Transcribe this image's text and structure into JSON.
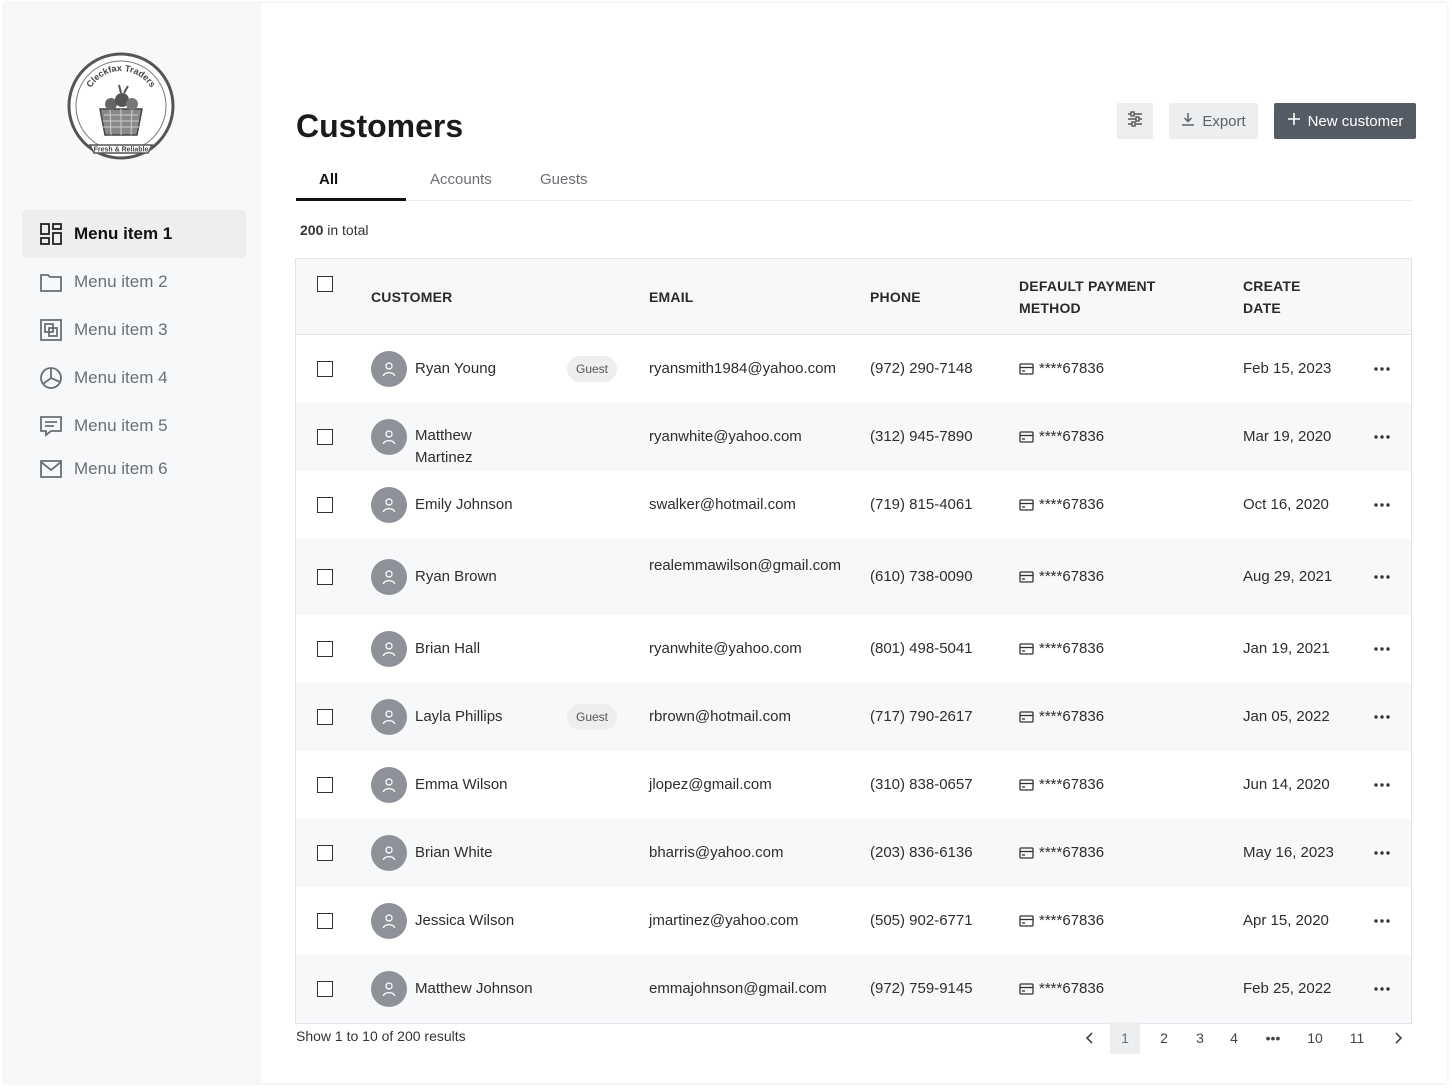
{
  "brand": {
    "logo_text_top": "Cleckfax Traders",
    "logo_text_bottom": "Fresh & Reliable"
  },
  "sidebar": {
    "items": [
      {
        "label": "Menu item 1",
        "icon": "dashboard-icon"
      },
      {
        "label": "Menu item 2",
        "icon": "folder-icon"
      },
      {
        "label": "Menu item 3",
        "icon": "layers-icon"
      },
      {
        "label": "Menu item 4",
        "icon": "pie-chart-icon"
      },
      {
        "label": "Menu item 5",
        "icon": "message-icon"
      },
      {
        "label": "Menu item 6",
        "icon": "mail-icon"
      }
    ]
  },
  "header": {
    "title": "Customers",
    "export_label": "Export",
    "new_label": "New customer"
  },
  "tabs": [
    "All",
    "Accounts",
    "Guests"
  ],
  "summary": {
    "count": "200",
    "suffix": " in total"
  },
  "table": {
    "headers": {
      "customer": "CUSTOMER",
      "email": "EMAIL",
      "phone": "PHONE",
      "payment_line1": "DEFAULT PAYMENT",
      "payment_line2": "METHOD",
      "date_line1": "CREATE",
      "date_line2": "DATE"
    },
    "rows": [
      {
        "name": "Ryan Young",
        "badge": "Guest",
        "email": "ryansmith1984@yahoo.com",
        "phone": "(972) 290-7148",
        "payment": "****67836",
        "date": "Feb 15, 2023"
      },
      {
        "name": "Matthew Martinez",
        "badge": "",
        "email": "ryanwhite@yahoo.com",
        "phone": "(312) 945-7890",
        "payment": "****67836",
        "date": "Mar 19, 2020"
      },
      {
        "name": "Emily Johnson",
        "badge": "",
        "email": "swalker@hotmail.com",
        "phone": "(719) 815-4061",
        "payment": "****67836",
        "date": "Oct 16, 2020"
      },
      {
        "name": "Ryan Brown",
        "badge": "",
        "email": "realemmawilson@gmail.com",
        "phone": "(610) 738-0090",
        "payment": "****67836",
        "date": "Aug 29, 2021"
      },
      {
        "name": "Brian Hall",
        "badge": "",
        "email": "ryanwhite@yahoo.com",
        "phone": "(801) 498-5041",
        "payment": "****67836",
        "date": "Jan 19, 2021"
      },
      {
        "name": "Layla Phillips",
        "badge": "Guest",
        "email": "rbrown@hotmail.com",
        "phone": "(717) 790-2617",
        "payment": "****67836",
        "date": "Jan 05, 2022"
      },
      {
        "name": "Emma Wilson",
        "badge": "",
        "email": "jlopez@gmail.com",
        "phone": "(310) 838-0657",
        "payment": "****67836",
        "date": "Jun 14, 2020"
      },
      {
        "name": "Brian White",
        "badge": "",
        "email": "bharris@yahoo.com",
        "phone": "(203) 836-6136",
        "payment": "****67836",
        "date": "May 16, 2023"
      },
      {
        "name": "Jessica Wilson",
        "badge": "",
        "email": "jmartinez@yahoo.com",
        "phone": "(505) 902-6771",
        "payment": "****67836",
        "date": "Apr 15, 2020"
      },
      {
        "name": "Matthew Johnson",
        "badge": "",
        "email": "emmajohnson@gmail.com",
        "phone": "(972) 759-9145",
        "payment": "****67836",
        "date": "Feb 25, 2022"
      }
    ]
  },
  "footer": {
    "results_text": "Show 1 to 10 of 200 results",
    "pages": [
      "1",
      "2",
      "3",
      "4",
      "•••",
      "10",
      "11"
    ],
    "current_page": "1"
  }
}
